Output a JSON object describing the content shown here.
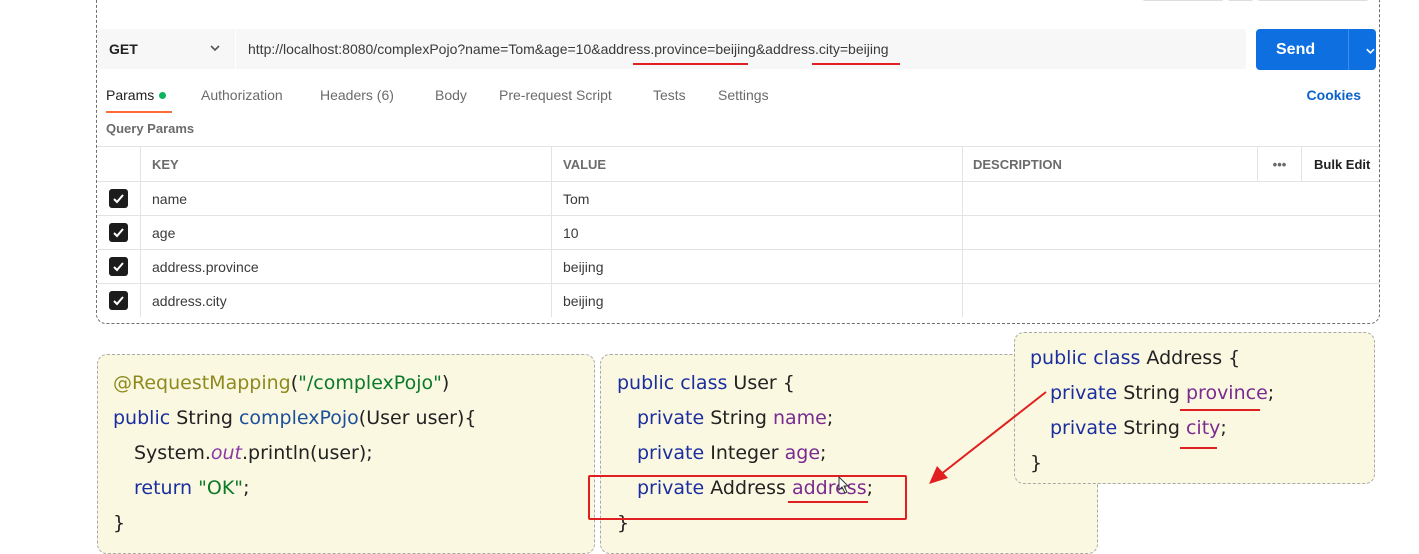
{
  "request": {
    "method": "GET",
    "url": "http://localhost:8080/complexPojo?name=Tom&age=10&address.province=beijing&address.city=beijing",
    "send_label": "Send"
  },
  "tabs": [
    {
      "label": "Params"
    },
    {
      "label": "Authorization"
    },
    {
      "label": "Headers (6)"
    },
    {
      "label": "Body"
    },
    {
      "label": "Pre-request Script"
    },
    {
      "label": "Tests"
    },
    {
      "label": "Settings"
    }
  ],
  "cookies_label": "Cookies",
  "query_params_label": "Query Params",
  "table": {
    "headers": {
      "key": "KEY",
      "value": "VALUE",
      "description": "DESCRIPTION",
      "more": "•••",
      "bulk_edit": "Bulk Edit"
    },
    "rows": [
      {
        "key": "name",
        "value": "Tom",
        "checked": true
      },
      {
        "key": "age",
        "value": "10",
        "checked": true
      },
      {
        "key": "address.province",
        "value": "beijing",
        "checked": true
      },
      {
        "key": "address.city",
        "value": "beijing",
        "checked": true
      }
    ]
  },
  "code_controller": {
    "annotation": "@RequestMapping",
    "mapping_path": "\"/complexPojo\"",
    "kw_public": "public",
    "return_type": "String",
    "method_name": "complexPojo",
    "params": "(User user){",
    "sys_prefix": "System.",
    "sys_out": "out",
    "sys_suffix": ".println(user);",
    "kw_return": "return",
    "ok_string": "\"OK\"",
    "close": "}"
  },
  "code_user": {
    "kw": "public class",
    "name": "User {",
    "fields": [
      {
        "kw": "private",
        "type": "String",
        "name": "name"
      },
      {
        "kw": "private",
        "type": "Integer",
        "name": "age"
      },
      {
        "kw": "private",
        "type": "Address",
        "name": "address"
      }
    ],
    "close": "}"
  },
  "code_address": {
    "kw": "public class",
    "name": "Address {",
    "fields": [
      {
        "kw": "private",
        "type": "String",
        "name": "province"
      },
      {
        "kw": "private",
        "type": "String",
        "name": "city"
      }
    ],
    "close": "}"
  },
  "colors": {
    "send": "#0d6fe0",
    "highlight": "#e02020",
    "keyword": "#1a2e9e",
    "field": "#7a2a90",
    "card_bg": "#fbf8e2"
  }
}
